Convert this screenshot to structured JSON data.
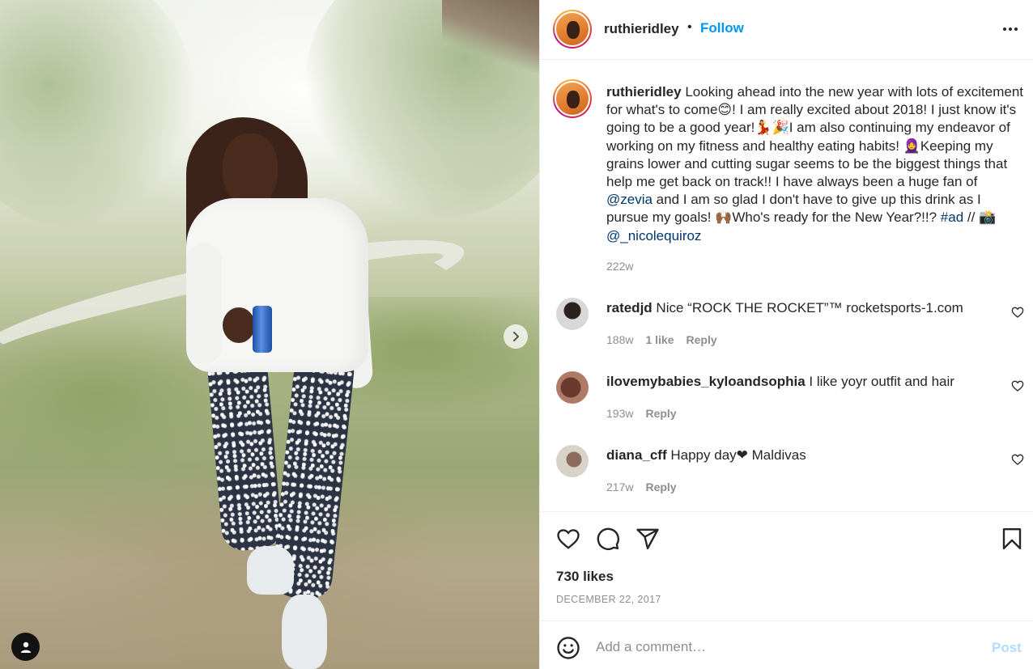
{
  "post": {
    "username": "ruthieridley",
    "separator": "•",
    "follow_label": "Follow",
    "caption": {
      "parts": [
        {
          "type": "text",
          "value": "Looking ahead into the new year with lots of excitement for what's to come😊! I am really excited about 2018! I just know it's going to be a good year!💃🎉I am also continuing my endeavor of working on my fitness and healthy eating habits! 🧕Keeping my grains lower and cutting sugar seems to be the biggest things that help me get back on track!! I have always been a huge fan of "
        },
        {
          "type": "mention",
          "value": "@zevia"
        },
        {
          "type": "text",
          "value": " and I am so glad I don't have to give up this drink as I pursue my goals! 🙌🏾Who's ready for the New Year?!!? "
        },
        {
          "type": "hashtag",
          "value": "#ad"
        },
        {
          "type": "text",
          "value": " // 📸 "
        },
        {
          "type": "mention",
          "value": "@_nicolequiroz"
        }
      ],
      "time": "222w"
    },
    "comments": [
      {
        "username": "ratedjd",
        "text": "Nice “ROCK THE ROCKET”™ rocketsports-1.com",
        "time": "188w",
        "likes": "1 like",
        "reply": "Reply",
        "avatar_color": "#d8d8d8"
      },
      {
        "username": "ilovemybabies_kyloandsophia",
        "text": "I like yoyr outfit and hair",
        "time": "193w",
        "likes": "",
        "reply": "Reply",
        "avatar_color": "#a46a5a"
      },
      {
        "username": "diana_cff",
        "text": "Happy day❤ Maldivas",
        "time": "217w",
        "likes": "",
        "reply": "Reply",
        "avatar_color": "#cfc6bd"
      }
    ],
    "likes": "730 likes",
    "date": "December 22, 2017",
    "add_comment_placeholder": "Add a comment…",
    "post_label": "Post"
  },
  "icons": {
    "like": "heart-icon",
    "comment": "comment-icon",
    "share": "paper-plane-icon",
    "save": "bookmark-icon",
    "emoji": "smiley-icon",
    "next": "chevron-right-icon",
    "tags": "user-tag-icon",
    "more": "more-options-icon"
  },
  "colors": {
    "accent": "#0095f6",
    "link": "#00376b",
    "muted": "#8e8e8e",
    "post_disabled": "#b3dbff"
  }
}
